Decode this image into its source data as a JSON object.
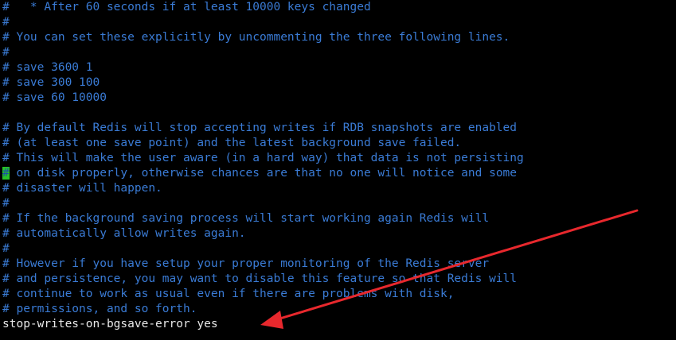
{
  "terminal": {
    "lines": [
      {
        "text": "#   * After 60 seconds if at least 10000 keys changed",
        "kind": "comment"
      },
      {
        "text": "#",
        "kind": "comment"
      },
      {
        "text": "# You can set these explicitly by uncommenting the three following lines.",
        "kind": "comment"
      },
      {
        "text": "#",
        "kind": "comment"
      },
      {
        "text": "# save 3600 1",
        "kind": "comment"
      },
      {
        "text": "# save 300 100",
        "kind": "comment"
      },
      {
        "text": "# save 60 10000",
        "kind": "comment"
      },
      {
        "text": "",
        "kind": "blank"
      },
      {
        "text": "# By default Redis will stop accepting writes if RDB snapshots are enabled",
        "kind": "comment"
      },
      {
        "text": "# (at least one save point) and the latest background save failed.",
        "kind": "comment"
      },
      {
        "text": "# This will make the user aware (in a hard way) that data is not persisting",
        "kind": "comment"
      },
      {
        "text": " on disk properly, otherwise chances are that no one will notice and some",
        "kind": "cursor",
        "cursor_char": "#"
      },
      {
        "text": "# disaster will happen.",
        "kind": "comment"
      },
      {
        "text": "#",
        "kind": "comment"
      },
      {
        "text": "# If the background saving process will start working again Redis will",
        "kind": "comment"
      },
      {
        "text": "# automatically allow writes again.",
        "kind": "comment"
      },
      {
        "text": "#",
        "kind": "comment"
      },
      {
        "text": "# However if you have setup your proper monitoring of the Redis server",
        "kind": "comment"
      },
      {
        "text": "# and persistence, you may want to disable this feature so that Redis will",
        "kind": "comment"
      },
      {
        "text": "# continue to work as usual even if there are problems with disk,",
        "kind": "comment"
      },
      {
        "text": "# permissions, and so forth.",
        "kind": "comment"
      },
      {
        "text": "stop-writes-on-bgsave-error yes",
        "kind": "plain"
      }
    ]
  },
  "colors": {
    "background": "#000000",
    "comment": "#3a7bd5",
    "plain": "#e8e8e8",
    "cursor_bg": "#27c227",
    "arrow": "#e8282d"
  },
  "annotation": {
    "icon": "red-arrow-icon"
  }
}
